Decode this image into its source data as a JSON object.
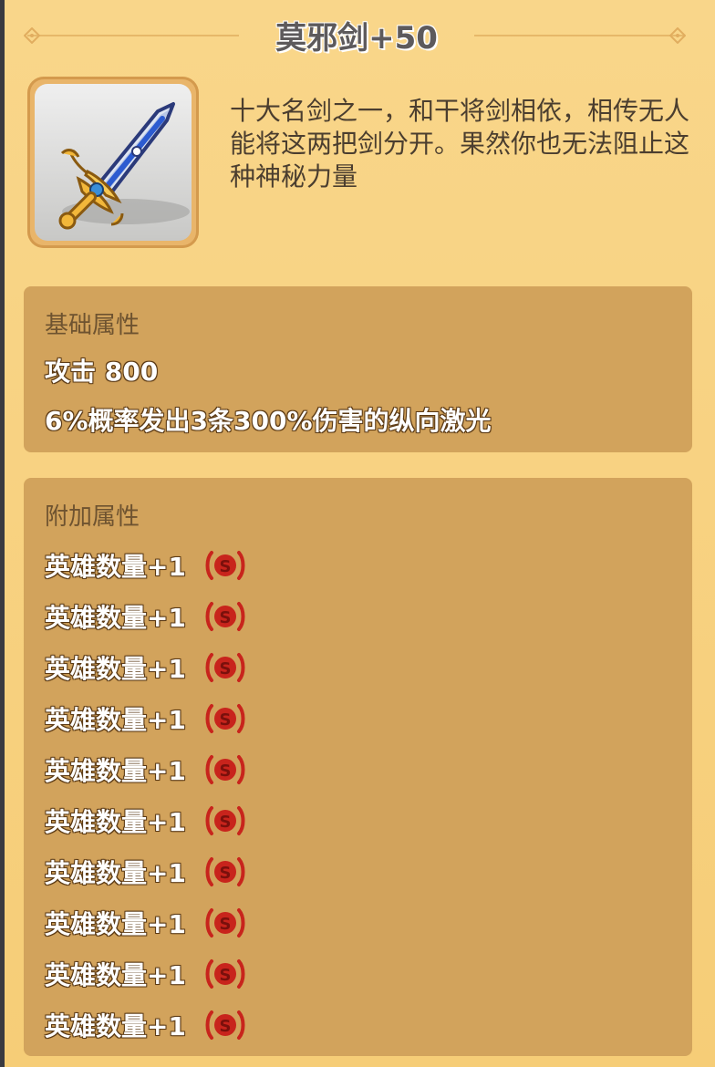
{
  "item": {
    "name": "莫邪剑+50",
    "description": "十大名剑之一，和干将剑相依，相传无人能将这两把剑分开。果然你也无法阻止这种神秘力量",
    "icon": "sword-icon"
  },
  "base_section": {
    "title": "基础属性",
    "attack": "攻击 800",
    "effect": "6%概率发出3条300%伤害的纵向激光"
  },
  "extra_section": {
    "title": "附加属性",
    "rows": [
      {
        "label": "英雄数量+1",
        "badge": "S"
      },
      {
        "label": "英雄数量+1",
        "badge": "S"
      },
      {
        "label": "英雄数量+1",
        "badge": "S"
      },
      {
        "label": "英雄数量+1",
        "badge": "S"
      },
      {
        "label": "英雄数量+1",
        "badge": "S"
      },
      {
        "label": "英雄数量+1",
        "badge": "S"
      },
      {
        "label": "英雄数量+1",
        "badge": "S"
      },
      {
        "label": "英雄数量+1",
        "badge": "S"
      },
      {
        "label": "英雄数量+1",
        "badge": "S"
      },
      {
        "label": "英雄数量+1",
        "badge": "S"
      }
    ]
  },
  "colors": {
    "background": "#f7cf7b",
    "section": "#d2a35c",
    "badge": "#c8241c"
  }
}
